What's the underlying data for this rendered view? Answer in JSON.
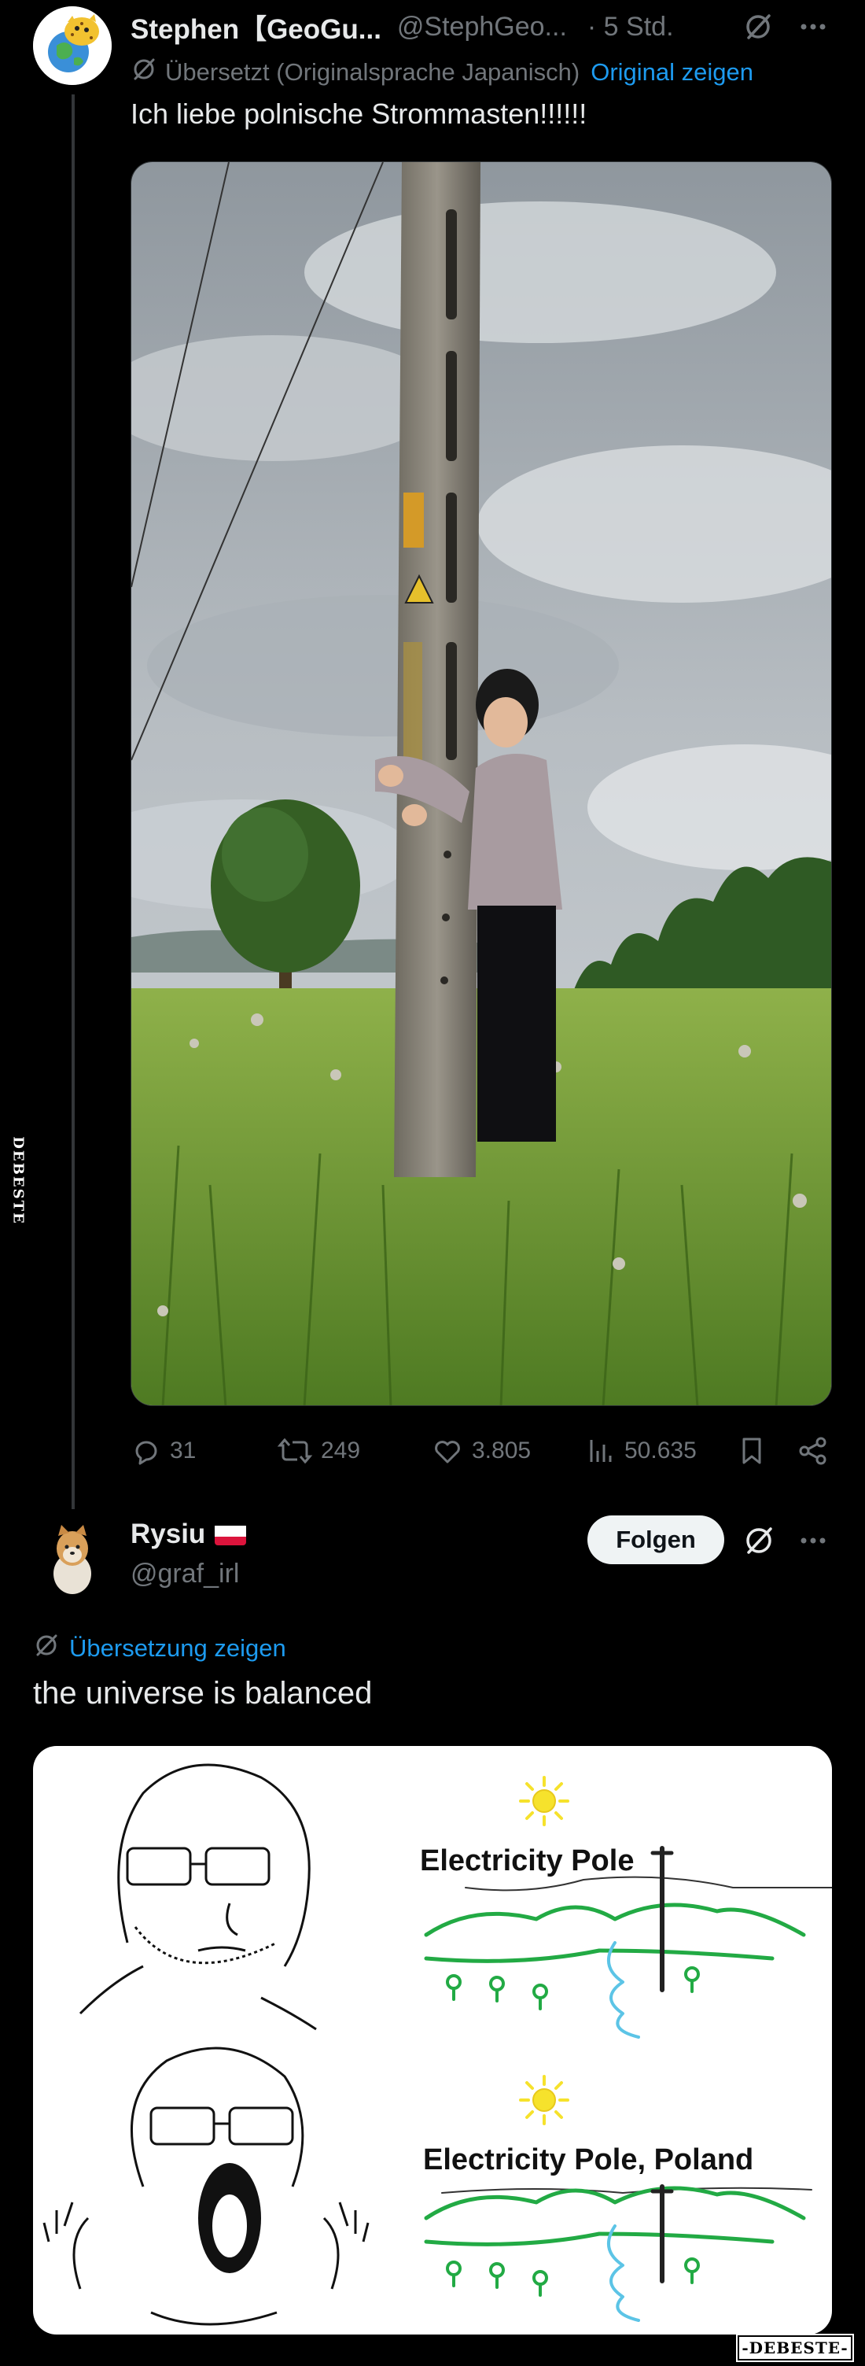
{
  "post1": {
    "display_name": "Stephen【GeoGu...",
    "handle": "@StephGeo...",
    "time": "· 5 Std.",
    "translated_note": "Übersetzt (Originalsprache Japanisch)",
    "show_original": "Original zeigen",
    "text": "Ich liebe polnische Strommasten!!!!!!",
    "replies": "31",
    "reposts": "249",
    "likes": "3.805",
    "views": "50.635"
  },
  "post2": {
    "display_name": "Rysiu",
    "flag": "Poland flag",
    "handle": "@graf_irl",
    "follow_label": "Folgen",
    "show_translation": "Übersetzung zeigen",
    "text": "the universe is balanced",
    "meme": {
      "label_top": "Electricity Pole",
      "label_bottom": "Electricity Pole, Poland"
    }
  },
  "icons": [
    "grok-icon",
    "more-icon",
    "reply-icon",
    "repost-icon",
    "like-icon",
    "views-icon",
    "bookmark-icon",
    "share-icon"
  ],
  "colors": {
    "background": "#000000",
    "link": "#1d9bf0",
    "muted": "#71767b",
    "text": "#e7e9ea"
  },
  "watermarks": {
    "side": "DEBESTE",
    "bottom": "-DEBESTE-"
  }
}
